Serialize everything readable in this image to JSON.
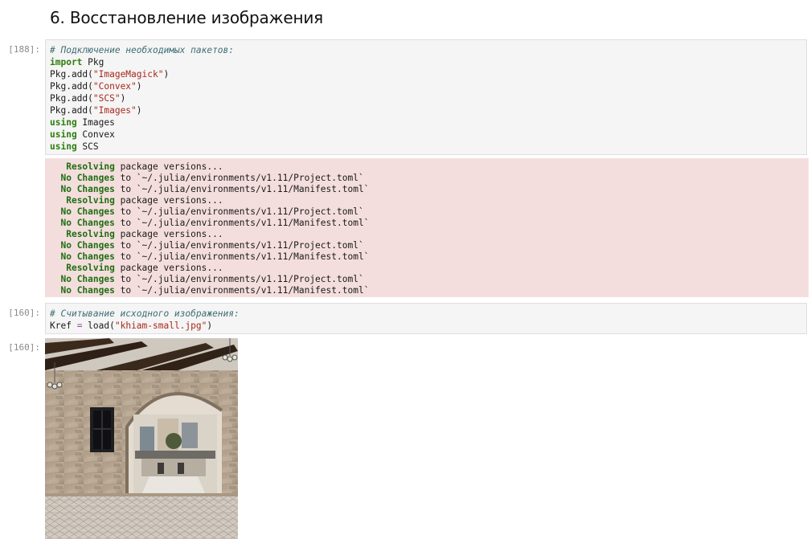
{
  "section_heading": "6. Восстановление изображения",
  "cells": {
    "c1": {
      "prompt": "[188]:",
      "comment": "# Подключение необходимых пакетов:",
      "kw_import": "import",
      "pkg": " Pkg",
      "add_prefix": "Pkg.add(",
      "add_suffix": ")",
      "packages": [
        "\"ImageMagick\"",
        "\"Convex\"",
        "\"SCS\"",
        "\"Images\""
      ],
      "kw_using": "using",
      "using_modules": [
        " Images",
        " Convex",
        " SCS"
      ]
    },
    "out1": {
      "resolving_word": "Resolving",
      "resolving_rest": " package versions...",
      "nochanges_word": "No Changes",
      "project_rest": " to `~/.julia/environments/v1.11/Project.toml`",
      "manifest_rest": " to `~/.julia/environments/v1.11/Manifest.toml`"
    },
    "c2": {
      "prompt": "[160]:",
      "comment": "# Считывание исходного изображения:",
      "var": "Kref ",
      "op": "=",
      "call_prefix": " load(",
      "filename": "\"khiam-small.jpg\"",
      "call_suffix": ")"
    },
    "out2": {
      "prompt": "[160]:"
    }
  },
  "colors": {
    "comment": "#3f6e74",
    "keyword": "#2e7d0e",
    "string": "#a8281b",
    "stderr_bg": "#f4dedd",
    "input_bg": "#f5f5f5"
  }
}
